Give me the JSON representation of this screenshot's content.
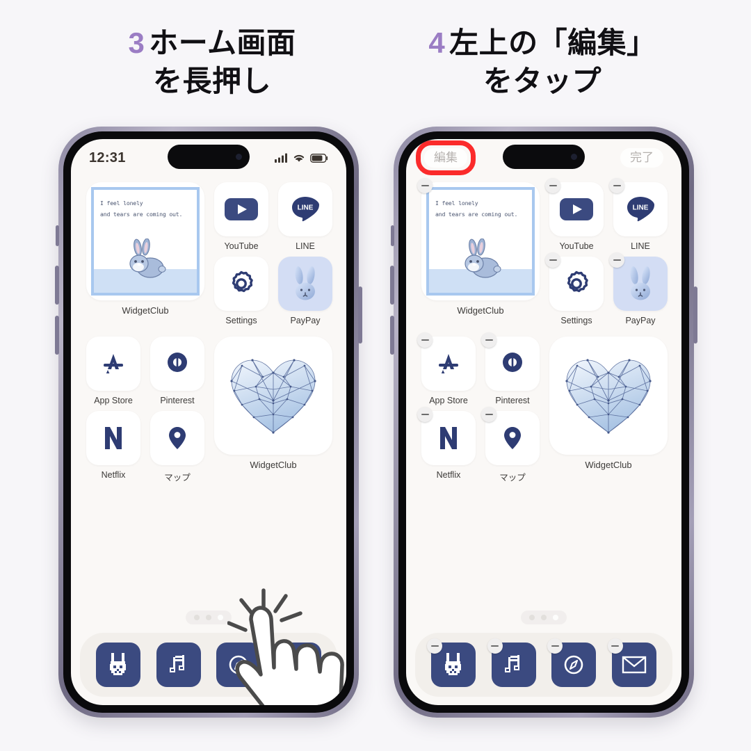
{
  "page": {
    "background_color": "#f7f6f9",
    "accent_number_color": "#9b7dc4",
    "highlight_ring_color": "#fb2b2b"
  },
  "steps": [
    {
      "number": "3",
      "title_line1": "ホーム画面",
      "title_line2": "を長押し"
    },
    {
      "number": "4",
      "title_line1": "左上の「編集」",
      "title_line2": "をタップ"
    }
  ],
  "phone1": {
    "name": "phone-step-3",
    "status": {
      "clock": "12:31",
      "signal_icon": "cellular-signal-icon",
      "wifi_icon": "wifi-icon",
      "battery_icon": "battery-icon"
    },
    "jiggle_mode": false,
    "widget": {
      "name": "quote-bunny-widget",
      "line1": "I feel lonely",
      "line2": "and tears are coming out.",
      "label": "WidgetClub",
      "border_color": "#a8c8ef",
      "ground_color": "#cfe0f5"
    },
    "apps_row1": [
      {
        "label": "YouTube",
        "icon": "youtube-icon"
      },
      {
        "label": "LINE",
        "icon": "line-icon"
      }
    ],
    "apps_row2": [
      {
        "label": "Settings",
        "icon": "gear-icon"
      },
      {
        "label": "PayPay",
        "icon": "bunny-head-icon"
      }
    ],
    "apps_row3": [
      {
        "label": "App Store",
        "icon": "app-store-icon"
      },
      {
        "label": "Pinterest",
        "icon": "pinterest-icon"
      }
    ],
    "apps_row4": [
      {
        "label": "Netflix",
        "icon": "netflix-icon"
      },
      {
        "label": "マップ",
        "icon": "maps-pin-icon"
      }
    ],
    "heart_widget": {
      "label": "WidgetClub",
      "icon": "wireframe-heart-icon"
    },
    "page_dots": {
      "count": 3,
      "active_index": 2
    },
    "dock": [
      {
        "name": "dock-bunny",
        "icon": "pixel-bunny-icon"
      },
      {
        "name": "dock-music",
        "icon": "music-note-icon"
      },
      {
        "name": "dock-safari",
        "icon": "compass-icon"
      },
      {
        "name": "dock-mail",
        "icon": "envelope-icon"
      }
    ],
    "gesture": {
      "icon": "tap-hand-icon",
      "hint": "long press home screen"
    }
  },
  "phone2": {
    "name": "phone-step-4",
    "status": {
      "edit_label": "編集",
      "done_label": "完了",
      "signal_icon": "cellular-signal-icon"
    },
    "jiggle_mode": true,
    "widget": {
      "name": "quote-bunny-widget",
      "line1": "I feel lonely",
      "line2": "and tears are coming out.",
      "label": "WidgetClub",
      "border_color": "#a8c8ef",
      "ground_color": "#cfe0f5"
    },
    "apps_row1": [
      {
        "label": "YouTube",
        "icon": "youtube-icon"
      },
      {
        "label": "LINE",
        "icon": "line-icon"
      }
    ],
    "apps_row2": [
      {
        "label": "Settings",
        "icon": "gear-icon"
      },
      {
        "label": "PayPay",
        "icon": "bunny-head-icon"
      }
    ],
    "apps_row3": [
      {
        "label": "App Store",
        "icon": "app-store-icon"
      },
      {
        "label": "Pinterest",
        "icon": "pinterest-icon"
      }
    ],
    "apps_row4": [
      {
        "label": "Netflix",
        "icon": "netflix-icon"
      },
      {
        "label": "マップ",
        "icon": "maps-pin-icon"
      }
    ],
    "heart_widget": {
      "label": "WidgetClub",
      "icon": "wireframe-heart-icon"
    },
    "page_dots": {
      "count": 3,
      "active_index": 2
    },
    "dock": [
      {
        "name": "dock-bunny",
        "icon": "pixel-bunny-icon"
      },
      {
        "name": "dock-music",
        "icon": "music-note-icon"
      },
      {
        "name": "dock-safari",
        "icon": "compass-icon"
      },
      {
        "name": "dock-mail",
        "icon": "envelope-icon"
      }
    ],
    "gesture": {
      "icon": "tap-hand-icon",
      "hint": "tap edit button"
    }
  }
}
